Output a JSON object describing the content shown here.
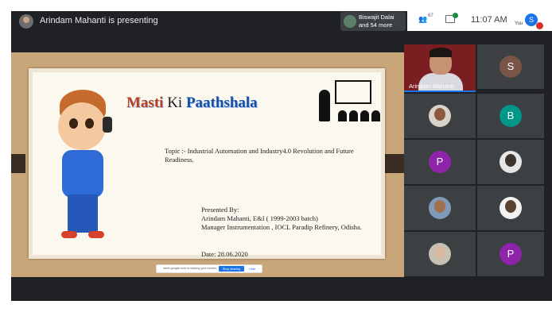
{
  "topbar": {
    "presenting_text": "Arindam Mahanti is presenting",
    "chip_line1": "Biswajit Dalai",
    "chip_line2": "and 54 more",
    "people_count": "67",
    "time": "11:07 AM",
    "you_label": "You",
    "self_initial": "S"
  },
  "slide": {
    "title_part1": "Masti",
    "title_part2": "Ki",
    "title_part3": "Paathshala",
    "topic": "Topic :- Industrial Automation and Industry4.0 Revolution and Future Readiness.",
    "presented_by": "Presented By:",
    "presenter_line1": "Arindam Mahanti, E&I ( 1999-2003 batch)",
    "presenter_line2": "Manager Instrumentation , IOCL Paradip Refinery, Odisha.",
    "date": "Date: 28.06.2020"
  },
  "sharebar": {
    "text": "meet.google.com is sharing your screen.",
    "stop_label": "Stop sharing",
    "hide_label": "Hide"
  },
  "tiles": {
    "main_name": "Arindam Mahanti",
    "letters": [
      "S",
      "B",
      "P",
      "P"
    ]
  },
  "colors": {
    "meet_dark": "#202124",
    "tile_bg": "#3c4043",
    "accent_blue": "#1a73e8",
    "tile_s": "#795548",
    "tile_b": "#009688",
    "tile_p": "#8e24aa",
    "mic_off_red": "#d93025"
  }
}
